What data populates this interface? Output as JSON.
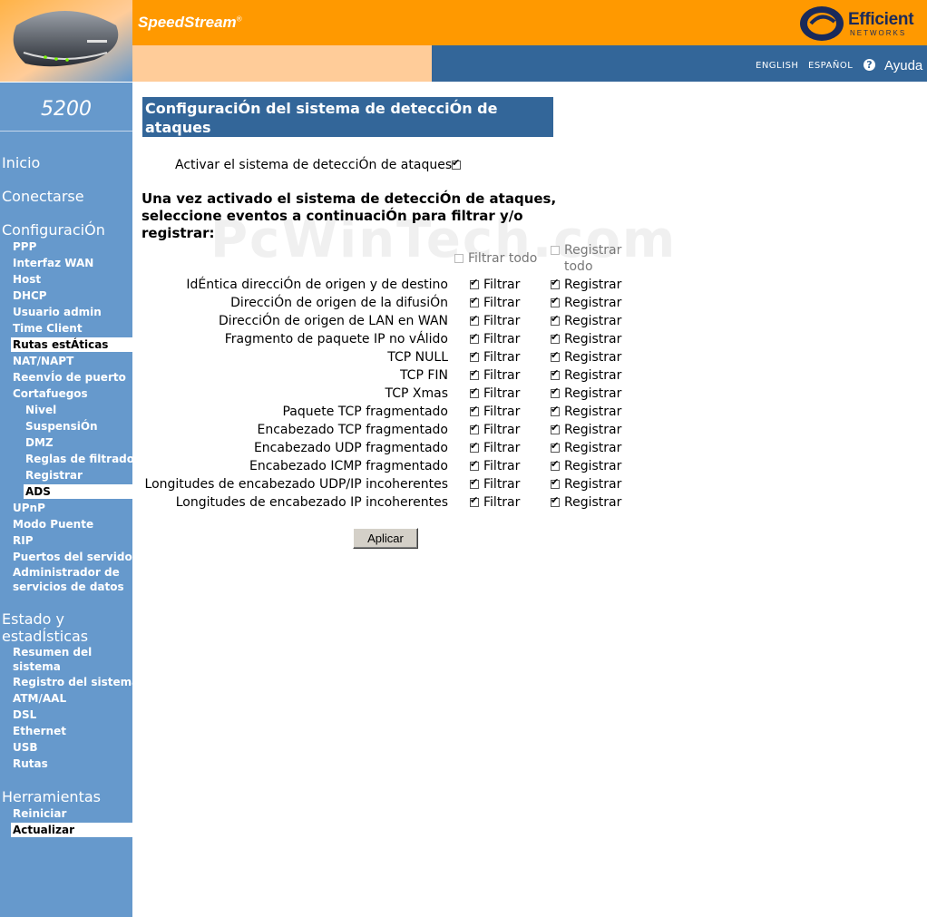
{
  "header": {
    "brand": "SpeedStream",
    "brand_mark": "®",
    "logo_word": "Efficient",
    "logo_sub": "NETWORKS",
    "lang_english": "ENGLISH",
    "lang_spanish": "ESPAÑOL",
    "help": "Ayuda",
    "colors": {
      "orange": "#ff9900",
      "peach": "#ffcc99",
      "blue": "#336699",
      "sidebar": "#6699cc"
    }
  },
  "sidebar": {
    "model": "5200",
    "inicio": "Inicio",
    "conectarse": "Conectarse",
    "configuracion": "ConfiguraciÓn",
    "config_items": [
      "PPP",
      "Interfaz WAN",
      "Host",
      "DHCP",
      "Usuario admin",
      "Time Client",
      "Rutas estÁticas",
      "NAT/NAPT",
      "ReenvÍo de puerto",
      "Cortafuegos"
    ],
    "firewall_items": [
      "Nivel",
      "SuspensiÓn",
      "DMZ",
      "Reglas de filtrado",
      "Registrar",
      "ADS"
    ],
    "config_items_2": [
      "UPnP",
      "Modo Puente",
      "RIP",
      "Puertos del servidor",
      "Administrador de servicios de datos"
    ],
    "estado": "Estado y estadÍsticas",
    "estado_items": [
      "Resumen del sistema",
      "Registro del sistema",
      "ATM/AAL",
      "DSL",
      "Ethernet",
      "USB",
      "Rutas"
    ],
    "herramientas": "Herramientas",
    "herramientas_items": [
      "Reiniciar",
      "Actualizar"
    ]
  },
  "main": {
    "title": "ConfiguraciÓn del sistema de detecciÓn de ataques",
    "enable_label": "Activar el sistema de detecciÓn de ataques",
    "enable_checked": true,
    "instructions": "Una vez activado el sistema de detecciÓn de ataques, seleccione eventos a continuaciÓn para filtrar y/o registrar:",
    "filter_all": "Filtrar todo",
    "log_all": "Registrar todo",
    "filter_label": "Filtrar",
    "log_label": "Registrar",
    "rows": [
      {
        "label": "IdÉntica direcciÓn de origen y de destino",
        "filter": true,
        "log": true
      },
      {
        "label": "DirecciÓn de origen de la difusiÓn",
        "filter": true,
        "log": true
      },
      {
        "label": "DirecciÓn de origen de LAN en WAN",
        "filter": true,
        "log": true
      },
      {
        "label": "Fragmento de paquete IP no vÁlido",
        "filter": true,
        "log": true
      },
      {
        "label": "TCP NULL",
        "filter": true,
        "log": true
      },
      {
        "label": "TCP FIN",
        "filter": true,
        "log": true
      },
      {
        "label": "TCP Xmas",
        "filter": true,
        "log": true
      },
      {
        "label": "Paquete TCP fragmentado",
        "filter": true,
        "log": true
      },
      {
        "label": "Encabezado TCP fragmentado",
        "filter": true,
        "log": true
      },
      {
        "label": "Encabezado UDP fragmentado",
        "filter": true,
        "log": true
      },
      {
        "label": "Encabezado ICMP fragmentado",
        "filter": true,
        "log": true
      },
      {
        "label": "Longitudes de encabezado UDP/IP incoherentes",
        "filter": true,
        "log": true
      },
      {
        "label": "Longitudes de encabezado IP incoherentes",
        "filter": true,
        "log": true
      }
    ],
    "apply_label": "Aplicar",
    "watermark": "PcWinTech.com"
  }
}
